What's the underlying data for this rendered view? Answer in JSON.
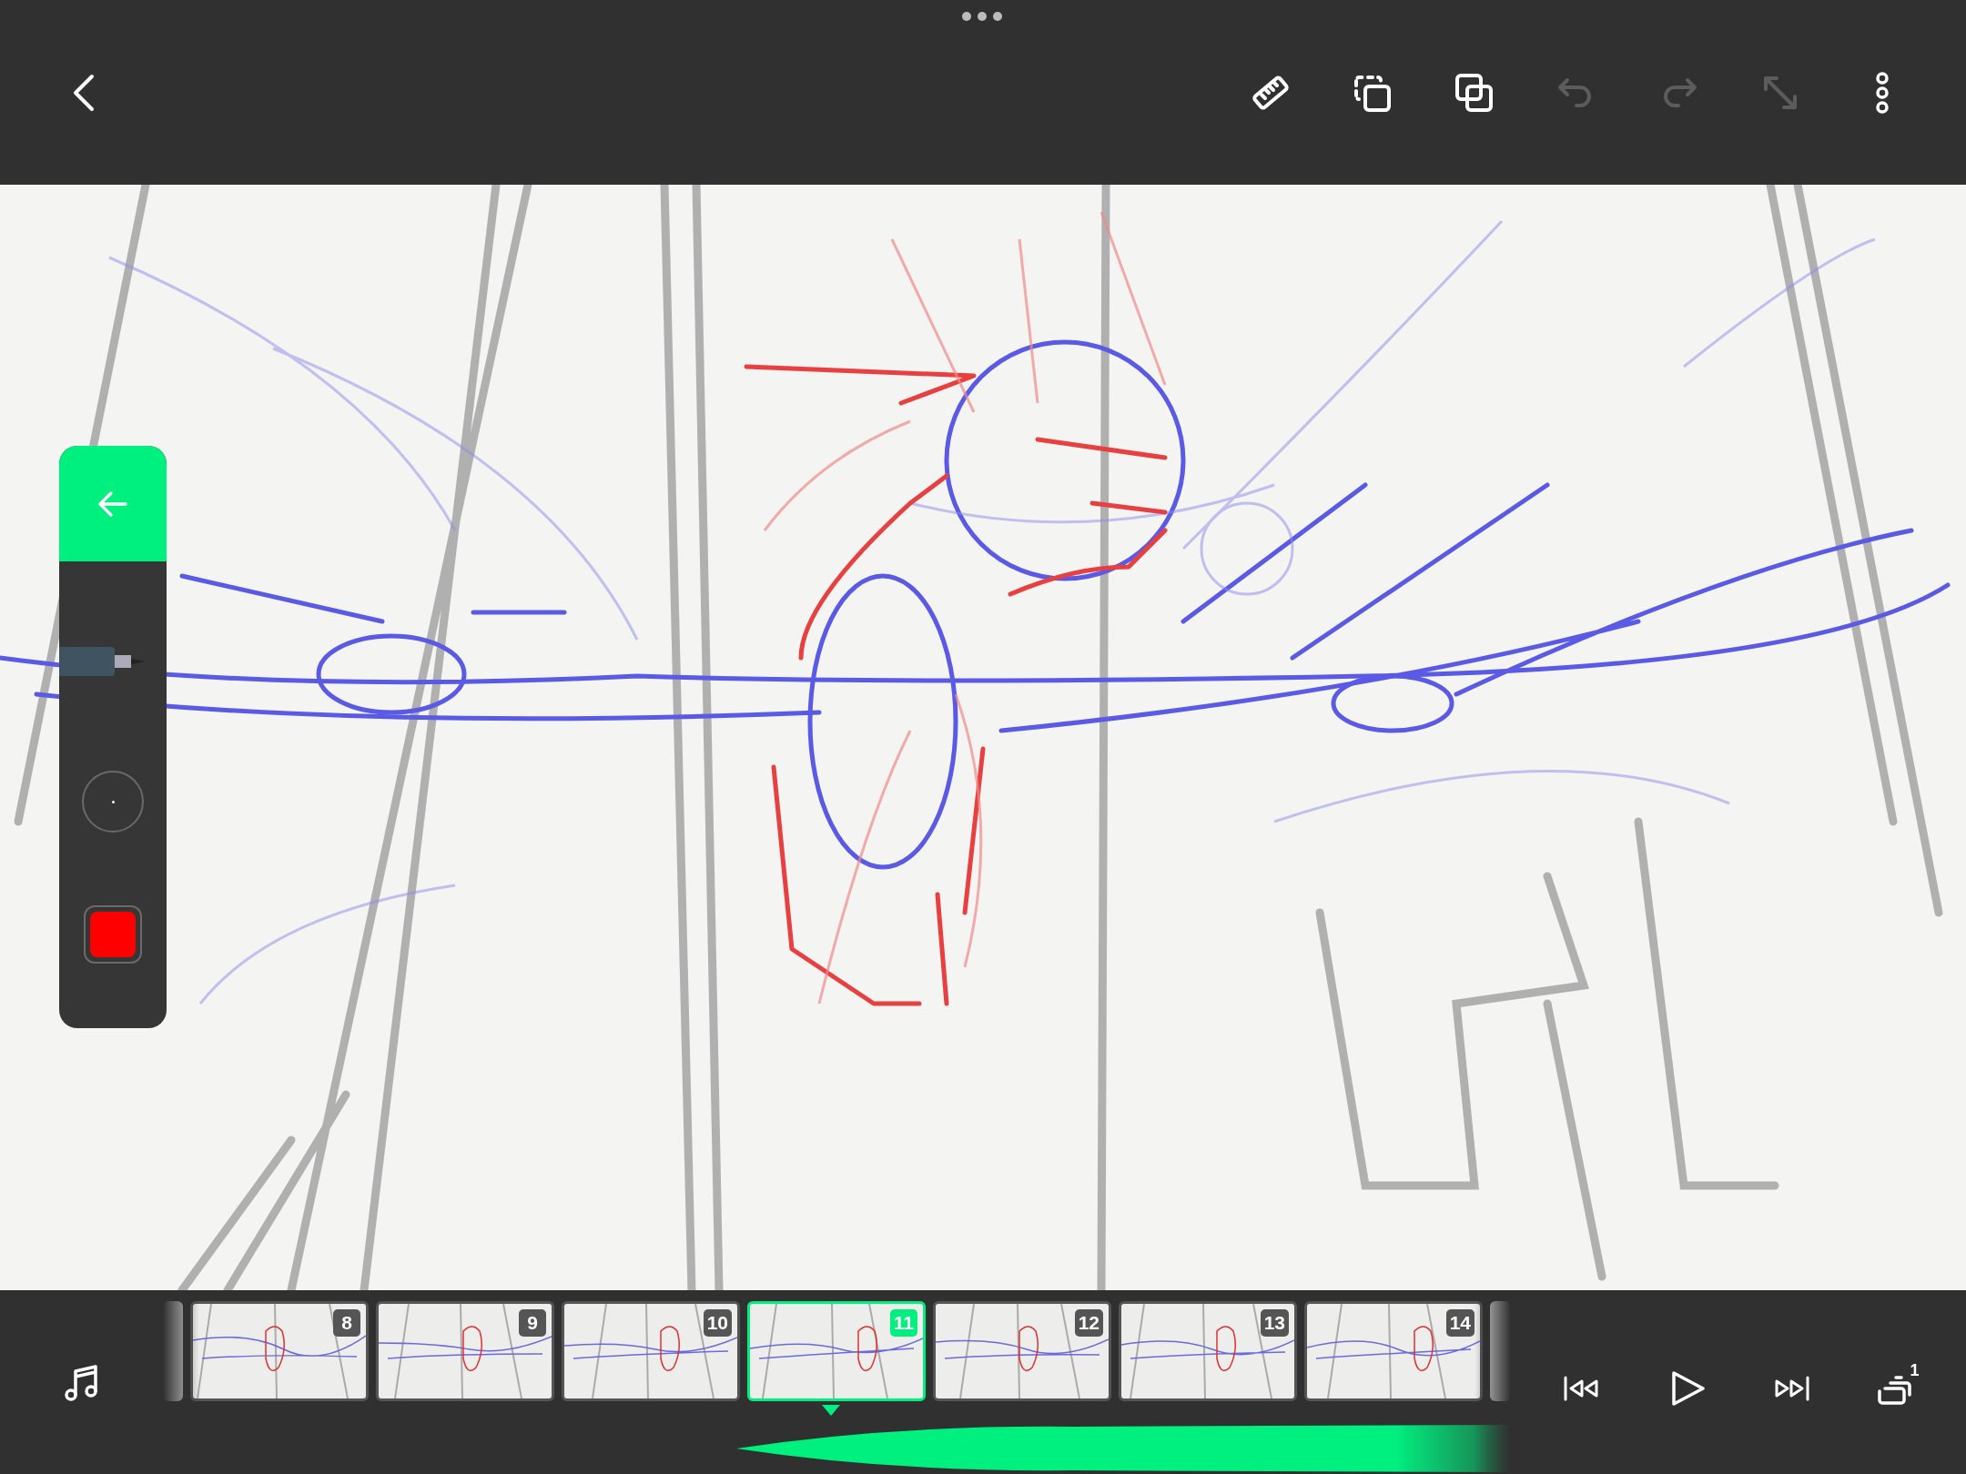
{
  "top_bar": {
    "tools": [
      {
        "kind": "ruler",
        "disabled": false
      },
      {
        "kind": "select-copy",
        "disabled": false
      },
      {
        "kind": "duplicate",
        "disabled": false
      },
      {
        "kind": "undo",
        "disabled": true
      },
      {
        "kind": "redo",
        "disabled": true
      },
      {
        "kind": "resize",
        "disabled": true
      },
      {
        "kind": "more",
        "disabled": false
      }
    ]
  },
  "tool_panel": {
    "color": "#ff0000"
  },
  "timeline": {
    "frames": [
      {
        "number": "8",
        "selected": false
      },
      {
        "number": "9",
        "selected": false
      },
      {
        "number": "10",
        "selected": false
      },
      {
        "number": "11",
        "selected": true
      },
      {
        "number": "12",
        "selected": false
      },
      {
        "number": "13",
        "selected": false
      },
      {
        "number": "14",
        "selected": false
      }
    ],
    "layers_badge": "1"
  }
}
